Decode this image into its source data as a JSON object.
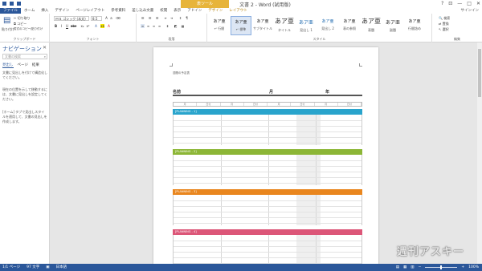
{
  "window": {
    "title": "文書 2 - Word (試用版)",
    "context_header": "表ツール",
    "controls": [
      "?",
      "⊡",
      "—",
      "□",
      "✕"
    ]
  },
  "tabs": [
    "ファイル",
    "ホーム",
    "挿入",
    "デザイン",
    "ページレイアウト",
    "参考資料",
    "差し込み文書",
    "校閲",
    "表示",
    "アドイン",
    "デザイン",
    "レイアウト"
  ],
  "signin": "サインイン",
  "ribbon": {
    "clipboard": {
      "paste": "貼り付け",
      "cut": "切り取り",
      "copy": "コピー",
      "format_painter": "書式のコピー/貼り付け",
      "label": "クリップボード"
    },
    "font": {
      "name": "ＭＳ ゴシック (本文)",
      "size": "8.5",
      "label": "フォント"
    },
    "paragraph": {
      "label": "段落"
    },
    "styles": {
      "label": "スタイル",
      "items": [
        {
          "sample": "あア亜",
          "name": "↵ 行間"
        },
        {
          "sample": "あア亜",
          "name": "↵ 標準"
        },
        {
          "sample": "あア亜",
          "name": "サブタイトル"
        },
        {
          "sample": "あア亜",
          "name": "タイトル"
        },
        {
          "sample": "あア亜",
          "name": "見出し 1"
        },
        {
          "sample": "あア亜",
          "name": "見出し 2"
        },
        {
          "sample": "あア亜",
          "name": "表の参照"
        },
        {
          "sample": "あア亜",
          "name": "表題"
        },
        {
          "sample": "あア亜",
          "name": "副題"
        },
        {
          "sample": "あア亜",
          "name": "行間詰め"
        }
      ]
    },
    "editing": {
      "find": "検索",
      "replace": "置換",
      "select": "選択",
      "label": "編集"
    }
  },
  "nav": {
    "title": "ナビゲーション",
    "search_placeholder": "文書の検索",
    "tabs": [
      "見出し",
      "ページ",
      "結果"
    ],
    "text1": "文書に見出しを付けて構造化してください。",
    "text2": "現在の位置を示して移動するには、文書に見出しを設定してください。",
    "text3": "[ホーム] タブで見出しスタイルを適用して、文書の見出しを作成します。"
  },
  "document": {
    "small_title": "週間の予定表",
    "labels": {
      "name": "名前",
      "month": "月",
      "year": "年"
    },
    "date_headers": [
      "月",
      "日付",
      "月",
      "日付",
      "月",
      "日付",
      "月",
      "日付"
    ],
    "sections": [
      {
        "label": "[PLANNING - 1]",
        "color": "#29a4cc"
      },
      {
        "label": "[PLANNING - 2]",
        "color": "#8cb636"
      },
      {
        "label": "[PLANNING - 3]",
        "color": "#e9861e"
      },
      {
        "label": "[PLANNING - 4]",
        "color": "#dc5678"
      }
    ]
  },
  "status": {
    "page": "1/1 ページ",
    "words": "97 文字",
    "lang": "日本語",
    "zoom": "100%"
  },
  "watermark": "週刊アスキー"
}
